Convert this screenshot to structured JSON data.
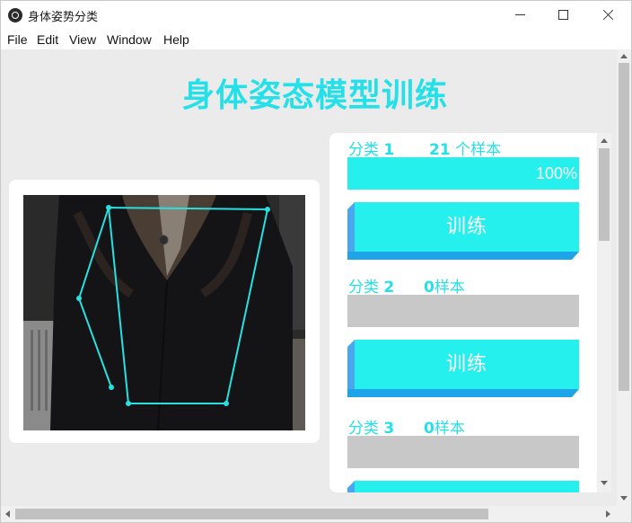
{
  "window": {
    "title": "身体姿势分类",
    "icon": "app-logo-icon",
    "controls": [
      "minimize-icon",
      "maximize-icon",
      "close-icon"
    ]
  },
  "menu": {
    "items": [
      "File",
      "Edit",
      "View",
      "Window",
      "Help"
    ]
  },
  "page": {
    "title": "身体姿态模型训练"
  },
  "camera": {
    "feed": "webcam-feed",
    "skeleton_color": "#28e0e0"
  },
  "classes": [
    {
      "label_prefix": "分类",
      "label_num": "1",
      "count_num": "21",
      "count_suffix": "个样本",
      "progress_percent": 100,
      "progress_text": "100%",
      "train_label": "训练"
    },
    {
      "label_prefix": "分类",
      "label_num": "2",
      "count_num": "0",
      "count_suffix": "样本",
      "progress_percent": 0,
      "progress_text": "",
      "train_label": "训练"
    },
    {
      "label_prefix": "分类",
      "label_num": "3",
      "count_num": "0",
      "count_suffix": "样本",
      "progress_percent": 0,
      "progress_text": "",
      "train_label": ""
    }
  ],
  "colors": {
    "accent": "#25e0e8",
    "progress_fill": "#25f0ee",
    "progress_empty": "#c8c8c8",
    "button_face": "#25f0ee",
    "button_shadow": "#1ea4e8"
  }
}
